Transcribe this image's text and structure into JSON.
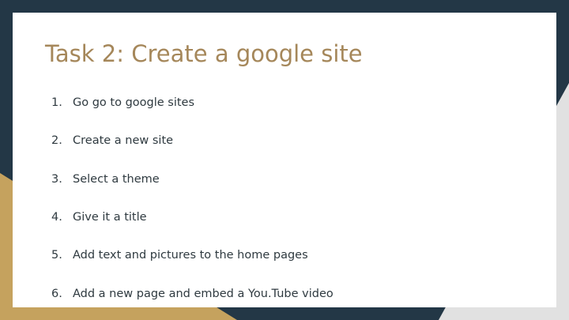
{
  "slide": {
    "title": "Task 2: Create a google site",
    "steps": [
      {
        "num": "1.",
        "text": "Go go to google sites"
      },
      {
        "num": "2.",
        "text": "Create a new site"
      },
      {
        "num": "3.",
        "text": "Select a theme"
      },
      {
        "num": "4.",
        "text": "Give it a title"
      },
      {
        "num": "5.",
        "text": "Add text and pictures to the home pages"
      },
      {
        "num": "6.",
        "text": "Add a new page and embed a You.Tube video"
      }
    ]
  },
  "colors": {
    "navy": "#233746",
    "gold": "#c5a25e",
    "light_gray": "#e1e1e1",
    "title": "#a5875a",
    "body_text": "#2f3a40"
  }
}
